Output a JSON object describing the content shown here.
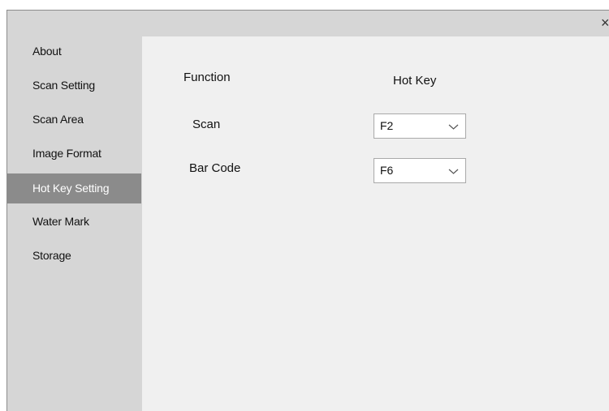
{
  "window": {
    "close_glyph": "×"
  },
  "sidebar": {
    "items": [
      {
        "label": "About"
      },
      {
        "label": "Scan Setting"
      },
      {
        "label": "Scan Area"
      },
      {
        "label": "Image Format"
      },
      {
        "label": "Hot Key Setting",
        "active": true
      },
      {
        "label": "Water Mark"
      },
      {
        "label": "Storage"
      }
    ]
  },
  "hotkeys": {
    "col_function": "Function",
    "col_hotkey": "Hot Key",
    "rows": [
      {
        "function": "Scan",
        "key": "F2"
      },
      {
        "function": "Bar Code",
        "key": "F6"
      }
    ]
  },
  "colors": {
    "active_bg": "#8b8b8b",
    "sidebar_bg": "#d6d6d6",
    "content_bg": "#f0f0f0"
  }
}
